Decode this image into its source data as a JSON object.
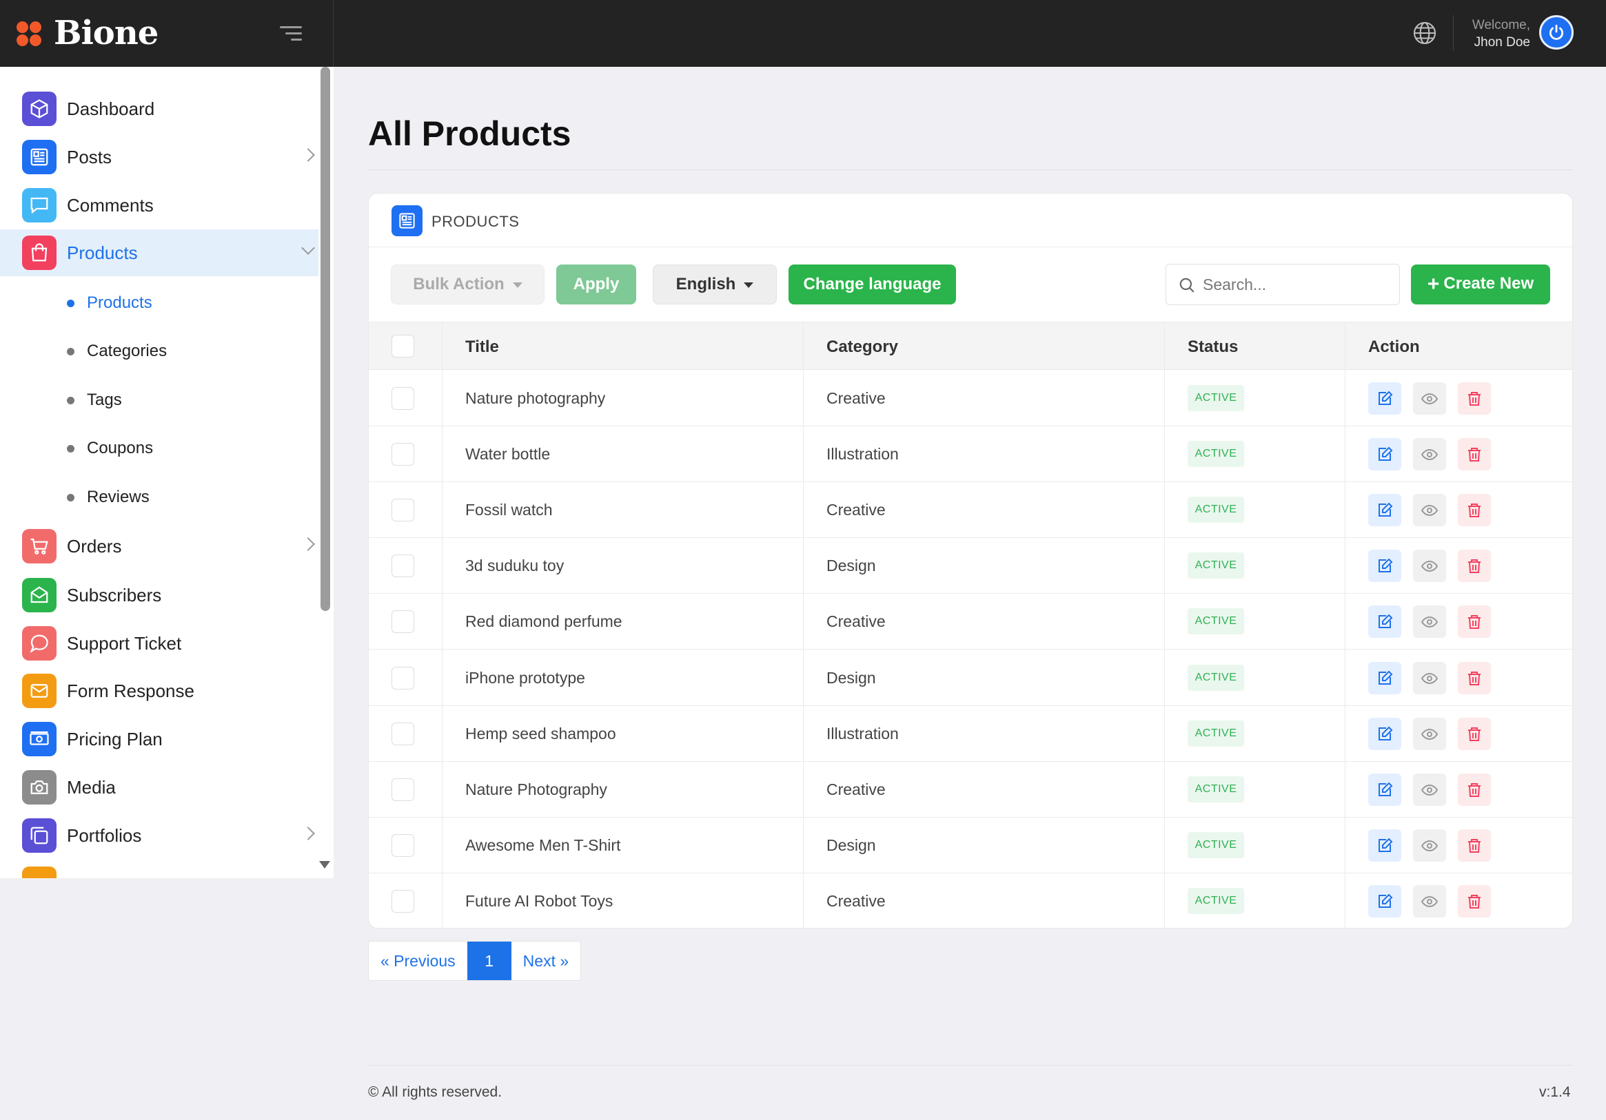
{
  "brand": {
    "name": "Bione"
  },
  "header": {
    "welcome": "Welcome,",
    "user_name": "Jhon Doe"
  },
  "sidebar": {
    "items": [
      {
        "label": "Dashboard",
        "color": "#5b4fd6"
      },
      {
        "label": "Posts",
        "color": "#1e6ff2"
      },
      {
        "label": "Comments",
        "color": "#43b8f5"
      },
      {
        "label": "Products",
        "color": "#f2405f"
      },
      {
        "label": "Orders",
        "color": "#f26b6b"
      },
      {
        "label": "Subscribers",
        "color": "#2bb44b"
      },
      {
        "label": "Support Ticket",
        "color": "#f26b6b"
      },
      {
        "label": "Form Response",
        "color": "#f39c12"
      },
      {
        "label": "Pricing Plan",
        "color": "#1e6ff2"
      },
      {
        "label": "Media",
        "color": "#8c8c8c"
      },
      {
        "label": "Portfolios",
        "color": "#5b4fd6"
      }
    ],
    "sub_items": [
      "Products",
      "Categories",
      "Tags",
      "Coupons",
      "Reviews"
    ]
  },
  "main": {
    "title": "All Products",
    "card_label": "PRODUCTS",
    "toolbar": {
      "bulk_action": "Bulk Action",
      "apply": "Apply",
      "language": "English",
      "change_language": "Change language",
      "search_placeholder": "Search...",
      "create_new": "Create New"
    },
    "table": {
      "columns": [
        "Title",
        "Category",
        "Status",
        "Action"
      ],
      "rows": [
        {
          "title": "Nature photography",
          "category": "Creative",
          "status": "ACTIVE"
        },
        {
          "title": "Water bottle",
          "category": "Illustration",
          "status": "ACTIVE"
        },
        {
          "title": "Fossil watch",
          "category": "Creative",
          "status": "ACTIVE"
        },
        {
          "title": "3d suduku toy",
          "category": "Design",
          "status": "ACTIVE"
        },
        {
          "title": "Red diamond perfume",
          "category": "Creative",
          "status": "ACTIVE"
        },
        {
          "title": "iPhone prototype",
          "category": "Design",
          "status": "ACTIVE"
        },
        {
          "title": "Hemp seed shampoo",
          "category": "Illustration",
          "status": "ACTIVE"
        },
        {
          "title": "Nature Photography",
          "category": "Creative",
          "status": "ACTIVE"
        },
        {
          "title": "Awesome Men T-Shirt",
          "category": "Design",
          "status": "ACTIVE"
        },
        {
          "title": "Future AI Robot Toys",
          "category": "Creative",
          "status": "ACTIVE"
        }
      ]
    },
    "pagination": {
      "previous": "« Previous",
      "current": "1",
      "next": "Next »"
    }
  },
  "footer": {
    "copyright": "© All rights reserved.",
    "version": "v:1.4"
  },
  "colors": {
    "accent": "#1e72e8",
    "success": "#2bb44b",
    "danger": "#f2405f",
    "header_bg": "#232323"
  },
  "icons": [
    "menu-icon",
    "globe-icon",
    "power-icon",
    "search-icon",
    "edit-icon",
    "eye-icon",
    "trash-icon",
    "plus-icon"
  ]
}
